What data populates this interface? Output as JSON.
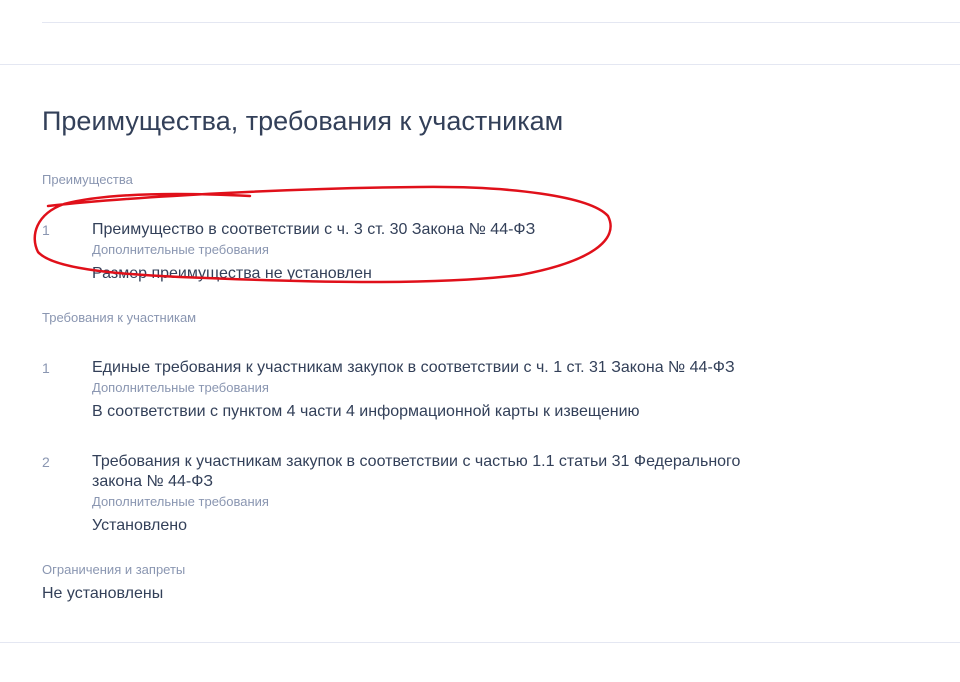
{
  "section": {
    "title": "Преимущества, требования к участникам"
  },
  "advantages": {
    "label": "Преимущества",
    "items": [
      {
        "number": "1",
        "title": "Преимущество в соответствии с ч. 3 ст. 30 Закона № 44-ФЗ",
        "subtitle": "Дополнительные требования",
        "value": "Размер преимущества не установлен"
      }
    ]
  },
  "requirements": {
    "label": "Требования к участникам",
    "items": [
      {
        "number": "1",
        "title": "Единые требования к участникам закупок в соответствии с ч. 1 ст. 31 Закона № 44-ФЗ",
        "subtitle": "Дополнительные требования",
        "value": "В соответствии с пунктом 4 части 4 информационной карты к извещению"
      },
      {
        "number": "2",
        "title": "Требования к участникам закупок в соответствии с частью 1.1 статьи 31 Федерального закона № 44-ФЗ",
        "subtitle": "Дополнительные требования",
        "value": "Установлено"
      }
    ]
  },
  "restrictions": {
    "label": "Ограничения и запреты",
    "value": "Не установлены"
  },
  "colors": {
    "text": "#334059",
    "muted": "#8a96b1",
    "divider": "#e4e7f2",
    "annotation": "#e0101a"
  }
}
